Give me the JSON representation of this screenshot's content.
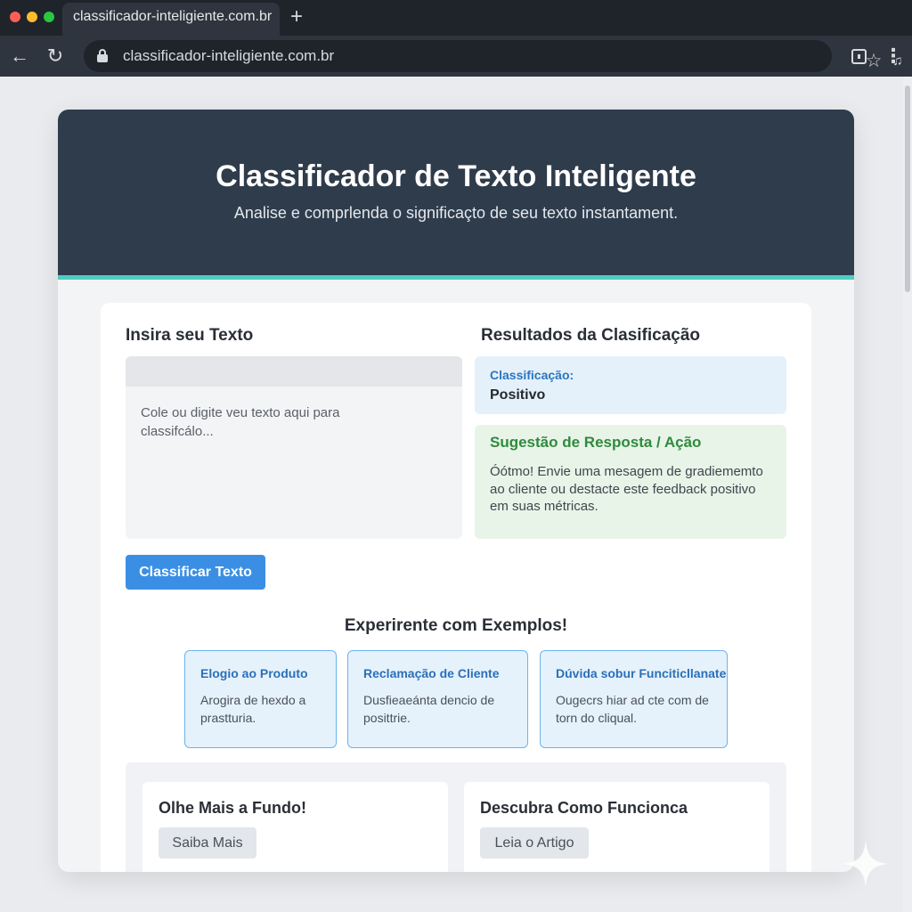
{
  "browser": {
    "tab_title": "classificador-inteligiente.com.br",
    "new_tab_glyph": "+",
    "url": "classificador-inteligiente.com.br",
    "icons": {
      "back": "back-arrow-icon",
      "reload": "reload-icon",
      "lock": "lock-icon",
      "bookmark": "star-icon",
      "extension": "extension-icon",
      "sidepanel": "side-panel-icon",
      "menu": "kebab-menu-icon"
    },
    "glyphs": {
      "back": "←",
      "reload": "↻",
      "star": "☆",
      "ext": "♫",
      "menu": "⋮"
    }
  },
  "hero": {
    "title": "Classificador de Texto Inteligente",
    "subtitle": "Analise e comprlenda o significaçto de seu texto instantament."
  },
  "input": {
    "heading": "Insira seu Texto",
    "placeholder": "Cole ou digite veu texto aqui para classifcálo...",
    "button_label": "Classificar Texto"
  },
  "results": {
    "heading": "Resultados da Clasificação",
    "classification_label": "Classificação:",
    "classification_value": "Positivo",
    "suggestion_title": "Sugestão de Resposta / Ação",
    "suggestion_text": "Óótmo! Envie uma mesagem de gradiememto ao cliente ou destacte este feedback positivo em suas métricas."
  },
  "examples": {
    "heading": "Experirente com Exemplos!",
    "items": [
      {
        "title": "Elogio ao Produto",
        "description": "Arogira de hexdo a prastturia."
      },
      {
        "title": "Reclamação de Cliente",
        "description": "Dusfieaeánta dencio de posittrie."
      },
      {
        "title": "Dúvida sobur Funciticllanate",
        "description": "Ougecrs hiar ad cte com de torn do cliqual."
      }
    ]
  },
  "footer_cards": [
    {
      "title": "Olhe Mais a Fundo!",
      "button_label": "Saiba Mais"
    },
    {
      "title": "Descubra Como Funcionca",
      "button_label": "Leia o Artigo"
    }
  ],
  "colors": {
    "hero_bg": "#2f3c4c",
    "accent_teal": "#4ecdc4",
    "primary_blue": "#3a8fe5",
    "success_green": "#2f8a3d"
  }
}
